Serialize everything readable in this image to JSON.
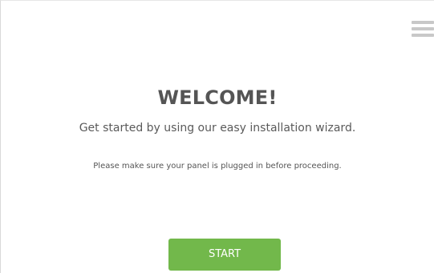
{
  "menu": {
    "icon": "hamburger-menu-icon"
  },
  "welcome": {
    "title": "WELCOME!",
    "subtitle": "Get started by using our easy installation wizard.",
    "notice": "Please make sure your panel is plugged in before proceeding."
  },
  "actions": {
    "start_label": "START"
  },
  "colors": {
    "accent": "#72b84b",
    "text": "#555555",
    "menu_icon": "#c8c8c8"
  }
}
